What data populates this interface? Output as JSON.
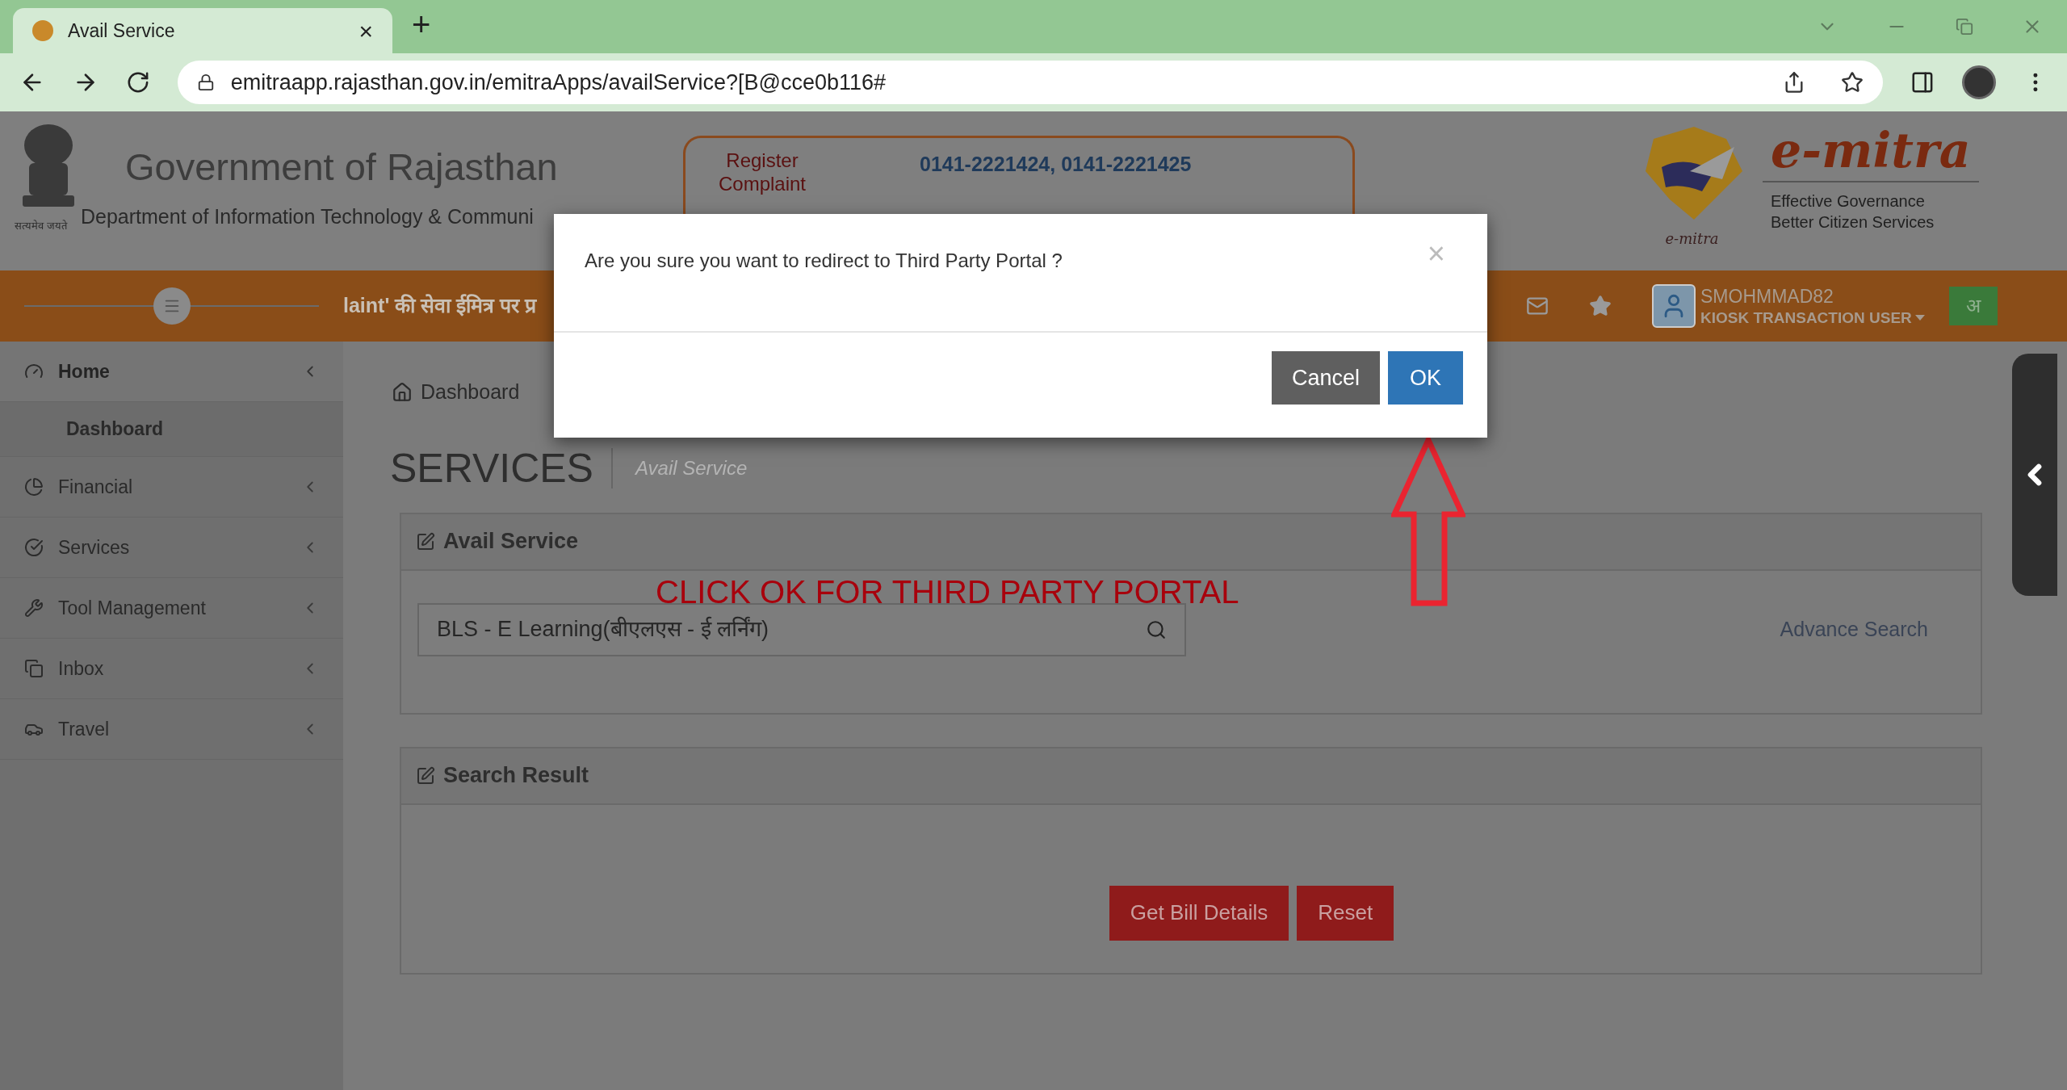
{
  "browser": {
    "tab_title": "Avail Service",
    "tab_close": "×",
    "new_tab": "+",
    "url": "emitraapp.rajasthan.gov.in/emitraApps/availService?[B@cce0b116#"
  },
  "header": {
    "title": "Government of Rajasthan",
    "emblem_motto": "सत्यमेव जयते",
    "department": "Department of Information Technology & Communi",
    "complaint_label": "Register Complaint",
    "phones": "0141-2221424, 0141-2221425",
    "logo_text": "e-mitra",
    "logo_small": "e-mitra",
    "tagline": [
      "Effective Governance",
      "Better Citizen Services"
    ]
  },
  "ticker": "laint' की सेवा ईमित्र पर प्र",
  "user": {
    "name": "SMOHMMAD82",
    "role": "KIOSK TRANSACTION USER",
    "language_button": "अ"
  },
  "sidebar": {
    "items": [
      {
        "label": "Home",
        "expanded": true,
        "children": [
          {
            "label": "Dashboard"
          }
        ]
      },
      {
        "label": "Financial",
        "expanded": false
      },
      {
        "label": "Services",
        "expanded": false
      },
      {
        "label": "Tool Management",
        "expanded": false
      },
      {
        "label": "Inbox",
        "expanded": false
      },
      {
        "label": "Travel",
        "expanded": false
      }
    ]
  },
  "breadcrumb": "Dashboard",
  "page_title": "SERVICES",
  "page_subtitle": "Avail Service",
  "avail_panel": {
    "title": "Avail Service",
    "search_value": "BLS - E Learning(बीएलएस - ई लर्निंग)",
    "advance_link": "Advance Search"
  },
  "annotation": "CLICK OK FOR THIRD PARTY PORTAL",
  "result_panel": {
    "title": "Search Result",
    "buttons": [
      "Get Bill Details",
      "Reset"
    ]
  },
  "modal": {
    "message": "Are you sure you want to redirect to Third Party Portal ?",
    "close": "×",
    "buttons": [
      {
        "label": "Cancel",
        "kind": "secondary"
      },
      {
        "label": "OK",
        "kind": "primary"
      }
    ]
  }
}
